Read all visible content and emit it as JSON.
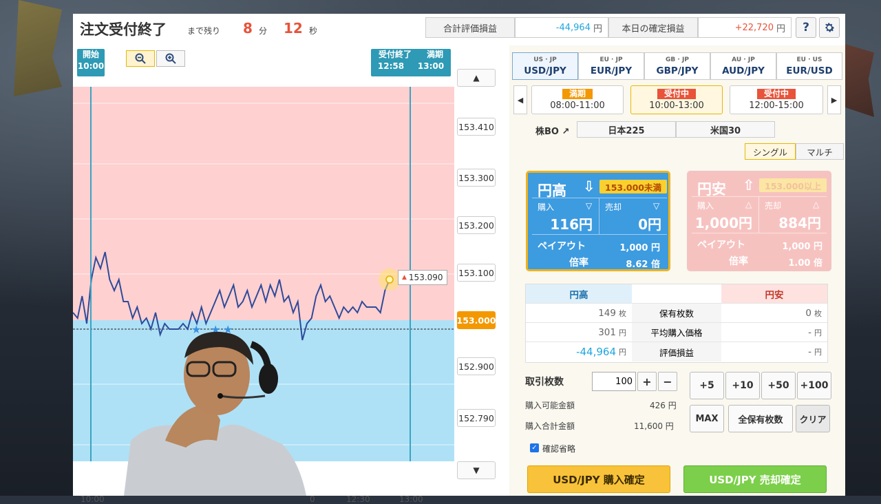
{
  "header": {
    "title": "注文受付終了",
    "remaining_label": "まで残り",
    "minutes": "8",
    "minutes_unit": "分",
    "seconds": "12",
    "seconds_unit": "秒",
    "total_pl_label": "合計評価損益",
    "total_pl_value": "-44,964",
    "total_pl_unit": "円",
    "today_pl_label": "本日の確定損益",
    "today_pl_value": "+22,720",
    "today_pl_unit": "円",
    "help_icon": "?",
    "colors": {
      "negative": "#1ea6e0",
      "positive": "#e8533a"
    }
  },
  "chart": {
    "start_label": "開始",
    "start_time": "10:00",
    "accept_end_label": "受付終了",
    "accept_end_time": "12:58",
    "expiry_label": "満期",
    "expiry_time": "13:00",
    "current_price_tag": "153.090",
    "x_ticks": [
      "10:00",
      "12:30",
      "13:00"
    ],
    "x_partial": "0"
  },
  "chart_data": {
    "type": "line",
    "title": "",
    "xlabel": "",
    "ylabel": "",
    "y_ticks": [
      "153.410",
      "153.300",
      "153.200",
      "153.100",
      "153.000",
      "152.900",
      "152.790"
    ],
    "strike": "153.000",
    "ylim": [
      152.76,
      153.44
    ],
    "x_range": [
      "10:00",
      "13:00"
    ],
    "series": [
      {
        "values": [
          153.03,
          153.02,
          153.06,
          153.01,
          153.09,
          153.13,
          153.11,
          153.14,
          153.09,
          153.07,
          153.09,
          153.05,
          153.05,
          153.02,
          153.04,
          153.01,
          153.02,
          153.0,
          153.03,
          152.99,
          153.01,
          153.0,
          153.0,
          153.0,
          153.01,
          153.0,
          153.03,
          153.01,
          153.04,
          153.01,
          153.03,
          153.05,
          153.07,
          153.04,
          153.06,
          153.08,
          153.04,
          153.05,
          153.07,
          153.04,
          153.06,
          153.08,
          153.05,
          153.08,
          153.06,
          153.09,
          153.05,
          153.06,
          153.03,
          153.05,
          152.98,
          153.01,
          153.02,
          153.06,
          153.08,
          153.05,
          153.06,
          153.04,
          153.02,
          153.04,
          153.03,
          153.04,
          153.03,
          153.05,
          153.04,
          153.04,
          153.04,
          153.03,
          153.07,
          153.09
        ]
      }
    ]
  },
  "pairs": [
    {
      "name": "USD/JPY",
      "flags": "US · JP"
    },
    {
      "name": "EUR/JPY",
      "flags": "EU · JP"
    },
    {
      "name": "GBP/JPY",
      "flags": "GB · JP"
    },
    {
      "name": "AUD/JPY",
      "flags": "AU · JP"
    },
    {
      "name": "EUR/USD",
      "flags": "EU · US"
    }
  ],
  "sessions": [
    {
      "tag": "満期",
      "time": "08:00-11:00",
      "tag_color": "#f39800"
    },
    {
      "tag": "受付中",
      "time": "10:00-13:00",
      "tag_color": "#e8533a"
    },
    {
      "tag": "受付中",
      "time": "12:00-15:00",
      "tag_color": "#e8533a"
    }
  ],
  "stock_bo": {
    "label": "株BO",
    "arrow": "↗",
    "items": [
      "日本225",
      "米国30"
    ]
  },
  "modes": [
    "シングル",
    "マルチ"
  ],
  "up_card": {
    "title": "円高",
    "arrow": "⇩",
    "condition": "153.000未満",
    "buy_label": "購入",
    "buy_value": "116円",
    "sell_label": "売却",
    "sell_value": "0円",
    "payout_label": "ペイアウト",
    "payout_value": "1,000 円",
    "rate_label": "倍率",
    "rate_value": "8.62 倍"
  },
  "down_card": {
    "title": "円安",
    "arrow": "⇧",
    "condition": "153.000以上",
    "buy_label": "購入",
    "buy_value": "1,000円",
    "sell_label": "売却",
    "sell_value": "884円",
    "payout_label": "ペイアウト",
    "payout_value": "1,000 円",
    "rate_label": "倍率",
    "rate_value": "1.00 倍"
  },
  "position": {
    "col_up": "円高",
    "col_down": "円安",
    "rows": [
      {
        "label": "保有枚数",
        "up": "149",
        "up_unit": "枚",
        "down": "0",
        "down_unit": "枚"
      },
      {
        "label": "平均購入価格",
        "up": "301",
        "up_unit": "円",
        "down": "-",
        "down_unit": "円"
      },
      {
        "label": "評価損益",
        "up": "-44,964",
        "up_unit": "円",
        "down": "-",
        "down_unit": "円"
      }
    ]
  },
  "order": {
    "qty_label": "取引枚数",
    "qty_value": "100",
    "plus": "+",
    "minus": "−",
    "add_buttons": [
      "+5",
      "+10",
      "+50",
      "+100"
    ],
    "available_label": "購入可能金額",
    "available_value": "426 円",
    "total_label": "購入合計金額",
    "total_value": "11,600 円",
    "max_label": "MAX",
    "all_label": "全保有枚数",
    "clear_label": "クリア",
    "skip_confirm_label": "確認省略",
    "buy_confirm": "USD/JPY 購入確定",
    "sell_confirm": "USD/JPY 売却確定"
  }
}
